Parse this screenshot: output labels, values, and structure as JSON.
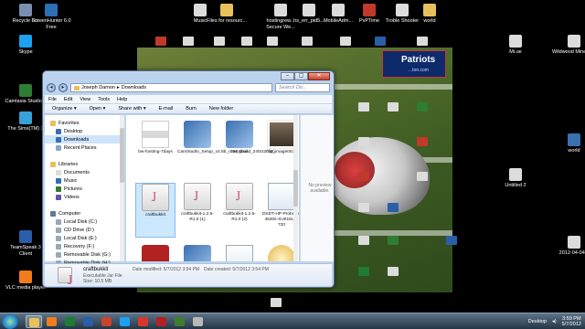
{
  "desktop_icons": [
    {
      "label": "Recycle Bin",
      "color": "#7a8fb1"
    },
    {
      "label": "ScreenHunter 6.0 Free",
      "color": "#2f6fb6"
    },
    {
      "label": "Music",
      "color": "#dcdcdc"
    },
    {
      "label": "Files for resourc...",
      "color": "#e9c15a"
    },
    {
      "label": "hostingrew... Secure We...",
      "color": "#dcdcdc"
    },
    {
      "label": "hs_err_pid5...",
      "color": "#dcdcdc"
    },
    {
      "label": "MobileAdm...",
      "color": "#dcdcdc"
    },
    {
      "label": "PvPTime",
      "color": "#c0392b"
    },
    {
      "label": "Troble Shooter",
      "color": "#dcdcdc"
    },
    {
      "label": "world",
      "color": "#e9c15a"
    },
    {
      "label": "Skype",
      "color": "#1da1f2"
    },
    {
      "label": "Camtasia Studio 7",
      "color": "#2e7d32"
    },
    {
      "label": "The Sims(TM) 3",
      "color": "#3aa0d8"
    },
    {
      "label": "TeamSpeak 3 Client",
      "color": "#2a5ea8"
    },
    {
      "label": "VLC media player",
      "color": "#f07c1b"
    },
    {
      "label": "Mi.ue",
      "color": "#dcdcdc"
    },
    {
      "label": "Wildwood Minecraft",
      "color": "#dcdcdc"
    },
    {
      "label": "world",
      "color": "#3a6fb0"
    },
    {
      "label": "Untitled 2",
      "color": "#dcdcdc"
    },
    {
      "label": "2012-04-04...",
      "color": "#dcdcdc"
    }
  ],
  "wallpaper": {
    "team": "Patriots",
    "site": "...ton.com"
  },
  "window": {
    "breadcrumb": [
      "Joseph Damon",
      "Downloads"
    ],
    "search_placeholder": "Search Do...",
    "menu": [
      "File",
      "Edit",
      "View",
      "Tools",
      "Help"
    ],
    "toolbar": [
      "Organize ▾",
      "Open ▾",
      "Share with ▾",
      "E-mail",
      "Burn",
      "New folder"
    ],
    "nav": [
      {
        "label": "Favorites",
        "indent": 0,
        "color": "#e9c15a",
        "selected": false
      },
      {
        "label": "Desktop",
        "indent": 1,
        "color": "#3a6fb0",
        "selected": false
      },
      {
        "label": "Downloads",
        "indent": 1,
        "color": "#3a6fb0",
        "selected": true
      },
      {
        "label": "Recent Places",
        "indent": 1,
        "color": "#8aa7c8",
        "selected": false
      },
      {
        "label": "",
        "indent": 0,
        "color": "transparent",
        "selected": false
      },
      {
        "label": "Libraries",
        "indent": 0,
        "color": "#e9c15a",
        "selected": false
      },
      {
        "label": "Documents",
        "indent": 1,
        "color": "#dcdcdc",
        "selected": false
      },
      {
        "label": "Music",
        "indent": 1,
        "color": "#2f6fb6",
        "selected": false
      },
      {
        "label": "Pictures",
        "indent": 1,
        "color": "#2e7d32",
        "selected": false
      },
      {
        "label": "Videos",
        "indent": 1,
        "color": "#6c4fa8",
        "selected": false
      },
      {
        "label": "",
        "indent": 0,
        "color": "transparent",
        "selected": false
      },
      {
        "label": "Computer",
        "indent": 0,
        "color": "#5c7a9a",
        "selected": false
      },
      {
        "label": "Local Disk (C:)",
        "indent": 1,
        "color": "#9aa8b8",
        "selected": false
      },
      {
        "label": "CD Drive (D:)",
        "indent": 1,
        "color": "#9aa8b8",
        "selected": false
      },
      {
        "label": "Local Disk (E:)",
        "indent": 1,
        "color": "#9aa8b8",
        "selected": false
      },
      {
        "label": "Recovery (F:)",
        "indent": 1,
        "color": "#9aa8b8",
        "selected": false
      },
      {
        "label": "Removable Disk (G:)",
        "indent": 1,
        "color": "#9aa8b8",
        "selected": false
      },
      {
        "label": "Removable Disk (H:)",
        "indent": 1,
        "color": "#9aa8b8",
        "selected": false
      }
    ],
    "files": [
      {
        "label": "bw-hosting-7days",
        "kind": "image-strip",
        "selected": false
      },
      {
        "label": "CamStudio_Setup_v2.6b_r294_(build_240ct2010)",
        "kind": "installer",
        "selected": false
      },
      {
        "label": "camtasia",
        "kind": "installer",
        "selected": false
      },
      {
        "label": "clip_image0031",
        "kind": "photo",
        "selected": false
      },
      {
        "label": "craftbukkit",
        "kind": "jar",
        "selected": true
      },
      {
        "label": "craftbukkit-1.2.5-R1.0 (1)",
        "kind": "jar",
        "selected": false
      },
      {
        "label": "craftbukkit-1.2.5-R1.0 (2)",
        "kind": "jar",
        "selected": false
      },
      {
        "label": "DSDT-HP-Probook-4530s-XU015UT-720",
        "kind": "doc",
        "selected": false
      },
      {
        "label": "",
        "kind": "filezilla",
        "selected": false
      },
      {
        "label": "",
        "kind": "installer",
        "selected": false
      },
      {
        "label": "",
        "kind": "doc",
        "selected": false
      },
      {
        "label": "",
        "kind": "sphere",
        "selected": false
      }
    ],
    "preview_text": "No preview available.",
    "details": {
      "name": "craftbukkit",
      "type": "Executable Jar File",
      "size": "Size: 10.5 MB",
      "modified": "Date modified: 5/7/2012 3:54 PM",
      "created": "Date created: 5/7/2012 3:54 PM"
    }
  },
  "taskbar": {
    "items": [
      {
        "name": "explorer",
        "color": "#e9c15a",
        "active": true
      },
      {
        "name": "media-player",
        "color": "#f07c1b",
        "active": false
      },
      {
        "name": "excel",
        "color": "#1e7b34",
        "active": false
      },
      {
        "name": "word",
        "color": "#2a5ea8",
        "active": false
      },
      {
        "name": "powerpoint",
        "color": "#c8452c",
        "active": false
      },
      {
        "name": "skype",
        "color": "#1da1f2",
        "active": false
      },
      {
        "name": "chrome",
        "color": "#d9372b",
        "active": false
      },
      {
        "name": "filezilla",
        "color": "#b22222",
        "active": false
      },
      {
        "name": "minecraft",
        "color": "#3f7d2e",
        "active": false
      },
      {
        "name": "java",
        "color": "#b8b8b8",
        "active": false
      }
    ],
    "tray_label": "Desktop",
    "time": "3:59 PM",
    "date": "5/7/2012"
  }
}
